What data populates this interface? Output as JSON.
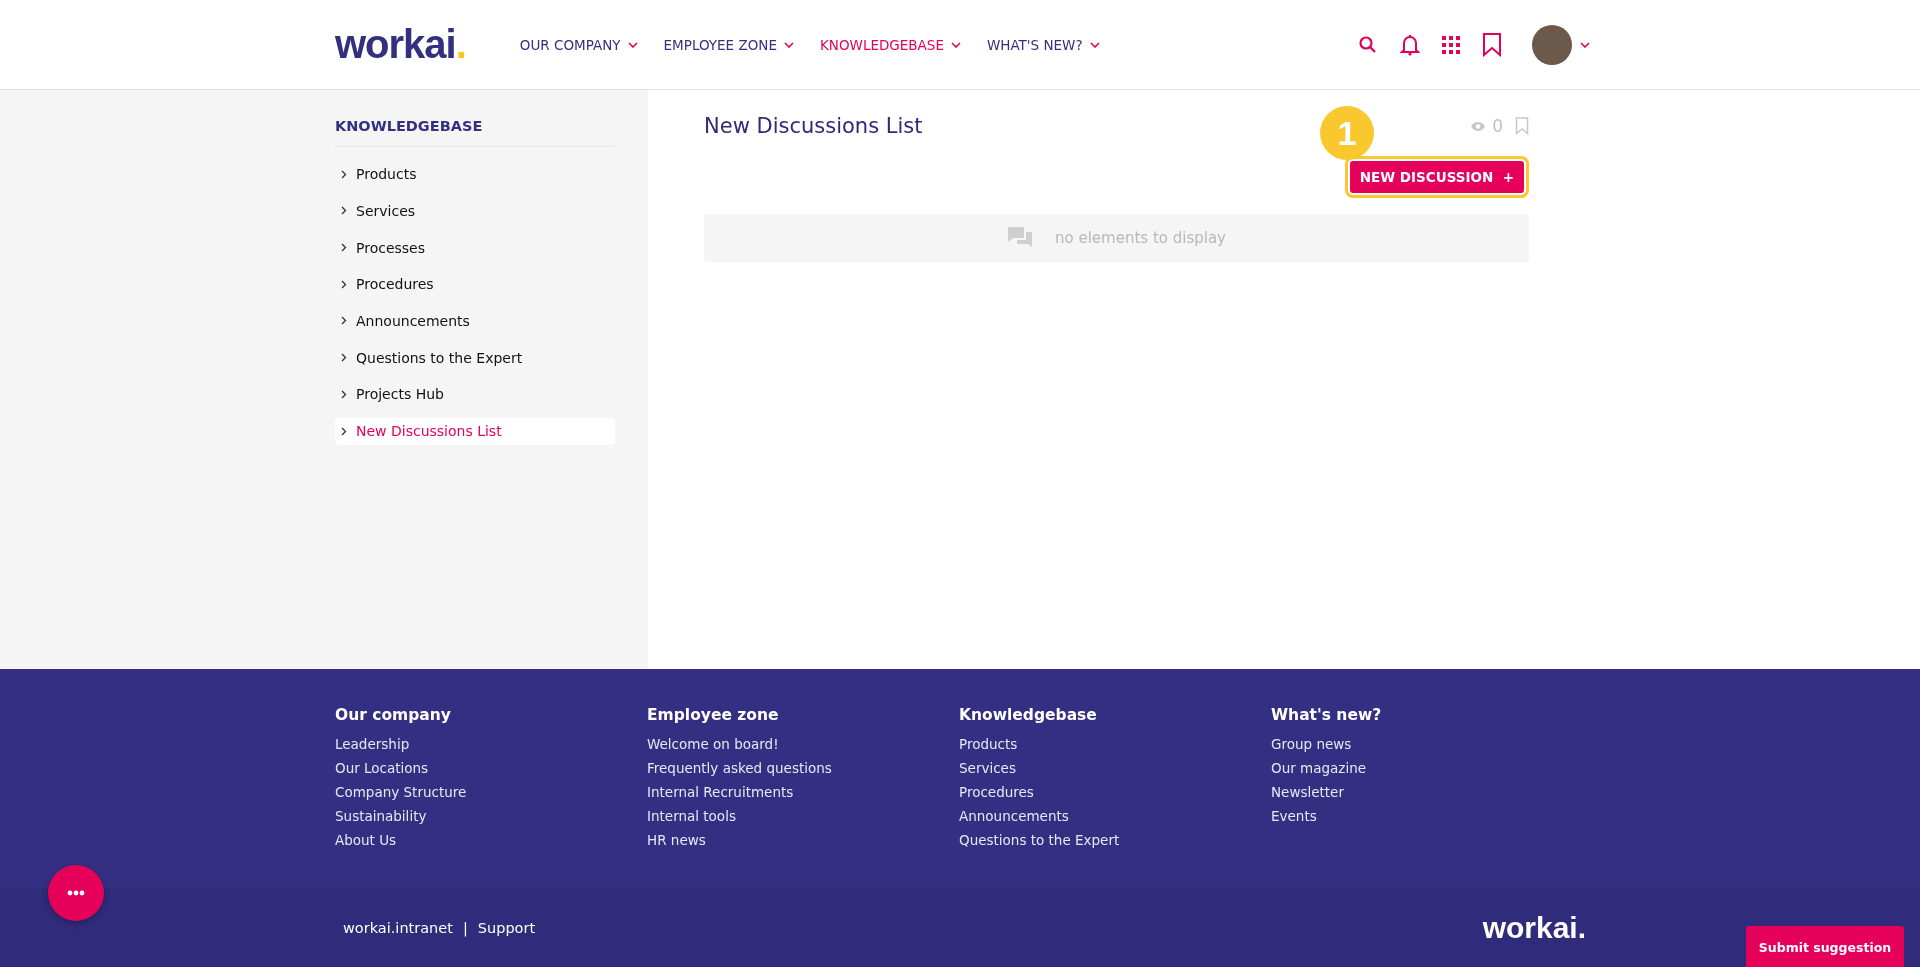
{
  "header": {
    "logo": {
      "text": "workai",
      "dot": "."
    },
    "nav": [
      {
        "label": "OUR COMPANY",
        "selected": false
      },
      {
        "label": "EMPLOYEE ZONE",
        "selected": false
      },
      {
        "label": "KNOWLEDGEBASE",
        "selected": true
      },
      {
        "label": "WHAT'S NEW?",
        "selected": false
      }
    ]
  },
  "sidebar": {
    "title": "KNOWLEDGEBASE",
    "items": [
      {
        "label": "Products",
        "selected": false
      },
      {
        "label": "Services",
        "selected": false
      },
      {
        "label": "Processes",
        "selected": false
      },
      {
        "label": "Procedures",
        "selected": false
      },
      {
        "label": "Announcements",
        "selected": false
      },
      {
        "label": "Questions to the Expert",
        "selected": false
      },
      {
        "label": "Projects Hub",
        "selected": false
      },
      {
        "label": "New Discussions List",
        "selected": true
      }
    ]
  },
  "main": {
    "title": "New Discussions List",
    "views": "0",
    "step_badge": "1",
    "new_button": "NEW DISCUSSION",
    "new_button_icon": "+",
    "empty_text": "no elements to display"
  },
  "footer": {
    "columns": [
      {
        "title": "Our company",
        "links": [
          "Leadership",
          "Our Locations",
          "Company Structure",
          "Sustainability",
          "About Us"
        ]
      },
      {
        "title": "Employee zone",
        "links": [
          "Welcome on board!",
          "Frequently asked questions",
          "Internal Recruitments",
          "Internal tools",
          "HR news"
        ]
      },
      {
        "title": "Knowledgebase",
        "links": [
          "Products",
          "Services",
          "Procedures",
          "Announcements",
          "Questions to the Expert"
        ]
      },
      {
        "title": "What's new?",
        "links": [
          "Group news",
          "Our magazine",
          "Newsletter",
          "Events"
        ]
      }
    ],
    "bottom_links": [
      "workai.intranet",
      "Support"
    ],
    "separator": "|",
    "logo": {
      "text": "workai",
      "dot": "."
    },
    "suggestion_button": "Submit suggestion"
  }
}
